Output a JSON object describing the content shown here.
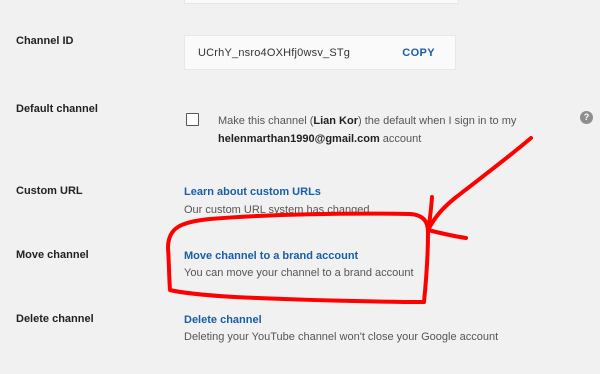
{
  "channel_id": {
    "label": "Channel ID",
    "value": "UCrhY_nsro4OXHfj0wsv_STg",
    "copy_label": "COPY"
  },
  "default_channel": {
    "label": "Default channel",
    "text_prefix": "Make this channel (",
    "channel_name": "Lian Kor",
    "text_middle": ") the default when I sign in to my",
    "email": "helenmarthan1990@gmail.com",
    "text_suffix": " account",
    "help_icon": "question-circle-icon",
    "help_symbol": "?"
  },
  "custom_url": {
    "label": "Custom URL",
    "link": "Learn about custom URLs",
    "description": "Our custom URL system has changed"
  },
  "move_channel": {
    "label": "Move channel",
    "link": "Move channel to a brand account",
    "description": "You can move your channel to a brand account"
  },
  "delete_channel": {
    "label": "Delete channel",
    "link": "Delete channel",
    "description": "Deleting your YouTube channel won't close your Google account"
  },
  "colors": {
    "background": "#f1f1f1",
    "link": "#1a5da8",
    "annotation": "#ff0000"
  }
}
